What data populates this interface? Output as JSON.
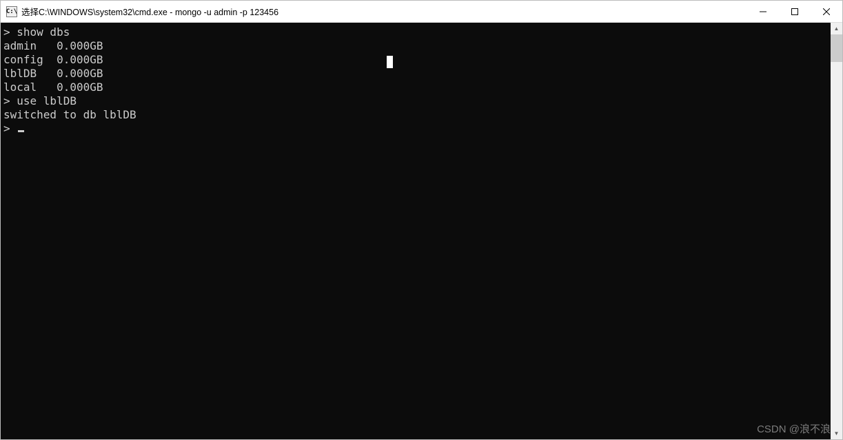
{
  "titlebar": {
    "icon_label": "C:\\",
    "title": "选择C:\\WINDOWS\\system32\\cmd.exe - mongo  -u admin -p 123456"
  },
  "terminal": {
    "lines": [
      "> show dbs",
      "admin   0.000GB",
      "config  0.000GB",
      "lblDB   0.000GB",
      "local   0.000GB",
      "> use lblDB",
      "switched to db lblDB",
      "> "
    ]
  },
  "scroll": {
    "up": "▲",
    "down": "▼"
  },
  "watermark": "CSDN @浪不浪"
}
